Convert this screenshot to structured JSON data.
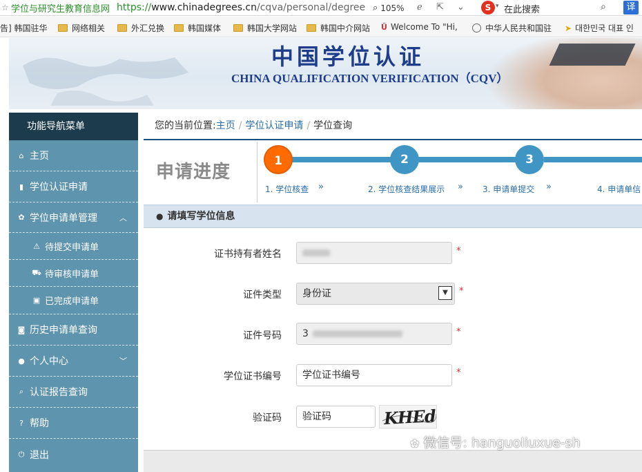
{
  "browser": {
    "site_title": "学位与研究生教育信息网",
    "url_scheme": "https://",
    "url_domain": "www.chinadegrees.cn",
    "url_path": "/cqva/personal/degree",
    "zoom": "105%",
    "search_engine": "S",
    "search_placeholder": "在此搜索",
    "translate_label": "译"
  },
  "bookmarks": [
    "告] 韩国驻华",
    "网络相关",
    "外汇兑换",
    "韩国媒体",
    "韩国大学网站",
    "韩国中介网站",
    "Welcome To \"Hi,",
    "中华人民共和国驻",
    "대한민국 대표 인"
  ],
  "banner": {
    "title": "中国学位认证",
    "subtitle": "CHINA QUALIFICATION VERIFICATION（CQV）"
  },
  "sidebar": {
    "header": "功能导航菜单",
    "items": [
      {
        "label": "主页",
        "icon": "home-icon"
      },
      {
        "label": "学位认证申请",
        "icon": "document-icon"
      },
      {
        "label": "学位申请单管理",
        "icon": "gear-icon"
      },
      {
        "label": "待提交申请单",
        "icon": "warning-icon"
      },
      {
        "label": "待审核申请单",
        "icon": "cart-icon"
      },
      {
        "label": "已完成申请单",
        "icon": "briefcase-icon"
      },
      {
        "label": "历史申请单查询",
        "icon": "camera-icon"
      },
      {
        "label": "个人中心",
        "icon": "user-icon"
      },
      {
        "label": "认证报告查询",
        "icon": "search-icon"
      },
      {
        "label": "帮助",
        "icon": "help-icon"
      },
      {
        "label": "退出",
        "icon": "power-icon"
      }
    ]
  },
  "breadcrumb": {
    "prefix": "您的当前位置:",
    "home": "主页",
    "parent": "学位认证申请",
    "current": "学位查询"
  },
  "progress": {
    "label": "申请进度",
    "steps": [
      {
        "number": "1",
        "label": "1. 学位核查",
        "status": "current"
      },
      {
        "number": "2",
        "label": "2. 学位核查结果展示",
        "status": "pending"
      },
      {
        "number": "3",
        "label": "3. 申请单提交",
        "status": "pending"
      },
      {
        "number": "4",
        "label": "4. 申请单信",
        "status": "pending"
      }
    ],
    "arrow": "»"
  },
  "form": {
    "header": "请填写学位信息",
    "fields": {
      "holder_name": {
        "label": "证书持有者姓名",
        "value": ""
      },
      "id_type": {
        "label": "证件类型",
        "value": "身份证"
      },
      "id_number": {
        "label": "证件号码",
        "value": "3"
      },
      "cert_number": {
        "label": "学位证书编号",
        "placeholder": "学位证书编号"
      },
      "captcha": {
        "label": "验证码",
        "placeholder": "验证码",
        "image_text": "KHEd"
      }
    },
    "required_mark": "*"
  },
  "watermark": "微信号: hanguoliuxue-sh",
  "colors": {
    "sidebar": "#5e94ad",
    "sidebar_header": "#1c3c4e",
    "step_done": "#ff6b00",
    "step_pending": "#3f95c4",
    "link": "#2a6ea8",
    "required": "#e03030"
  }
}
